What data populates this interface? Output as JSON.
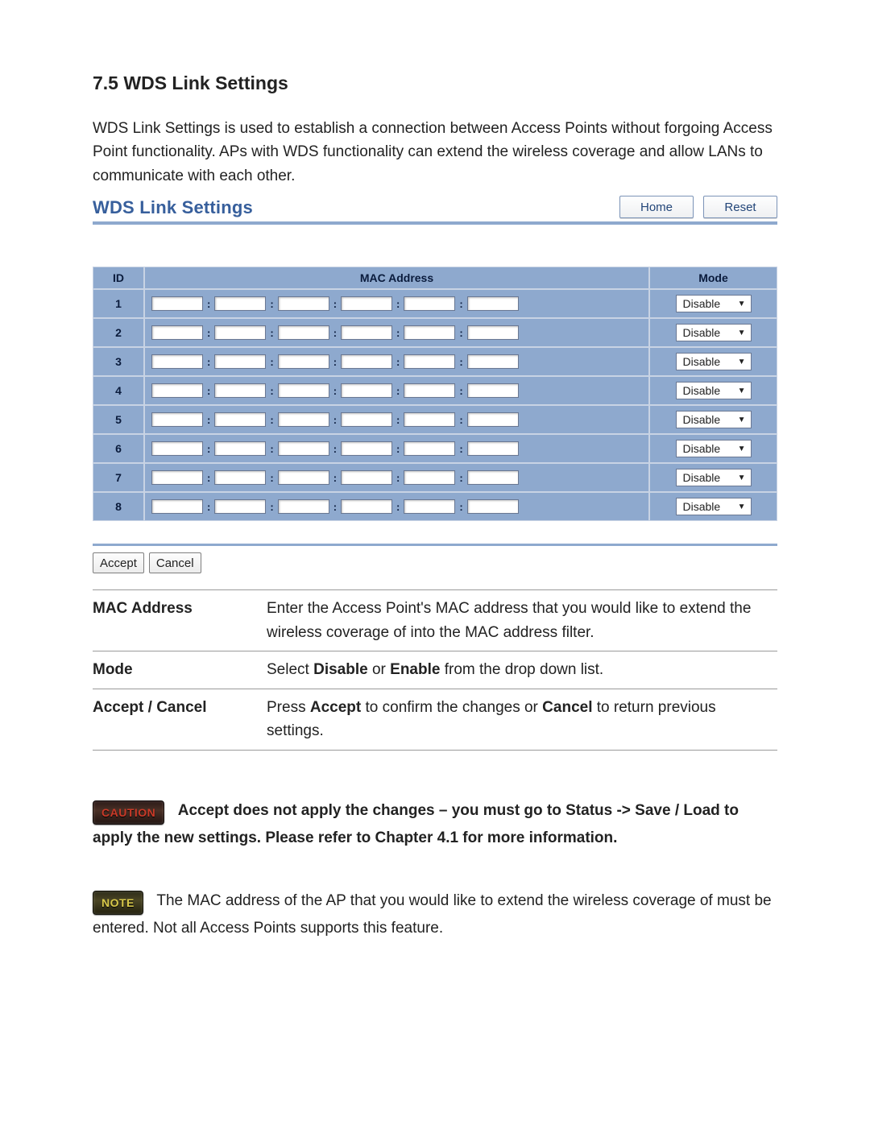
{
  "section": {
    "number": "7.5",
    "title": "WDS Link Settings",
    "intro": "WDS Link Settings is used to establish a connection between Access Points without forgoing Access Point functionality. APs with WDS functionality can extend the wireless coverage and allow LANs to communicate with each other."
  },
  "panel": {
    "title": "WDS Link Settings",
    "home_label": "Home",
    "reset_label": "Reset",
    "columns": {
      "id": "ID",
      "mac": "MAC Address",
      "mode": "Mode"
    },
    "mac_sep": ":",
    "rows": [
      {
        "id": "1",
        "mode": "Disable"
      },
      {
        "id": "2",
        "mode": "Disable"
      },
      {
        "id": "3",
        "mode": "Disable"
      },
      {
        "id": "4",
        "mode": "Disable"
      },
      {
        "id": "5",
        "mode": "Disable"
      },
      {
        "id": "6",
        "mode": "Disable"
      },
      {
        "id": "7",
        "mode": "Disable"
      },
      {
        "id": "8",
        "mode": "Disable"
      }
    ],
    "accept_label": "Accept",
    "cancel_label": "Cancel"
  },
  "desc": [
    {
      "term": "MAC Address",
      "text": "Enter the Access Point's MAC address that you would like to extend the wireless coverage of into the MAC address filter."
    },
    {
      "term": "Mode",
      "pre": "Select ",
      "b1": "Disable",
      "mid": " or ",
      "b2": "Enable",
      "post": " from the drop down list."
    },
    {
      "term": "Accept / Cancel",
      "pre": "Press ",
      "b1": "Accept",
      "mid": " to confirm the changes or ",
      "b2": "Cancel",
      "post": " to return previous settings."
    }
  ],
  "caution": {
    "badge": "CAUTION",
    "text": "Accept does not apply the changes – you must go to Status -> Save / Load to apply the new settings. Please refer to Chapter 4.1 for more information."
  },
  "note": {
    "badge": "NOTE",
    "text": "The MAC address of the AP that you would like to extend the wireless coverage of must be entered. Not all Access Points supports this feature."
  }
}
